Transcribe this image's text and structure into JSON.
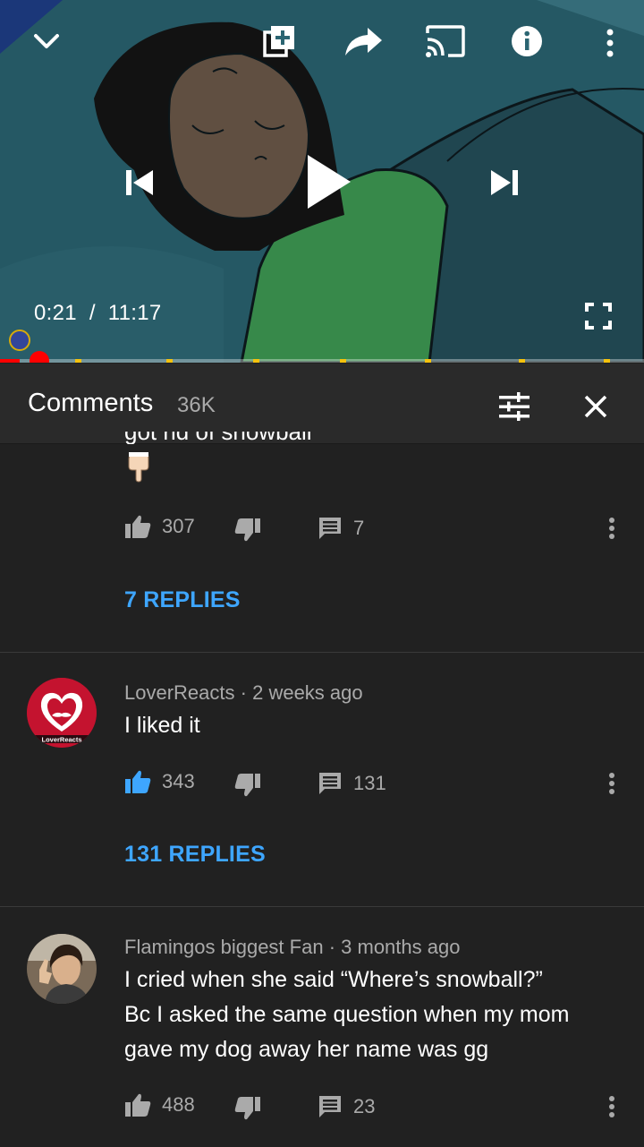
{
  "player": {
    "current_time": "0:21",
    "duration": "11:17",
    "progress_fraction": 0.031,
    "icons": [
      "chevron-down-icon",
      "add-to-playlist-icon",
      "share-icon",
      "cast-icon",
      "info-icon",
      "more-vert-icon",
      "previous-icon",
      "play-icon",
      "next-icon",
      "fullscreen-icon"
    ]
  },
  "comments_panel": {
    "title": "Comments",
    "count": "36K",
    "icons": [
      "sort-icon",
      "close-icon"
    ]
  },
  "comments": [
    {
      "author": "",
      "age": "",
      "text": "got rid of snowball",
      "likes": "307",
      "reply_count": "7",
      "replies_label": "7 REPLIES",
      "liked": false
    },
    {
      "author": "LoverReacts",
      "age": "2 weeks ago",
      "text": "I liked it",
      "likes": "343",
      "reply_count": "131",
      "replies_label": "131 REPLIES",
      "liked": true,
      "avatar_text": "LoverReacts"
    },
    {
      "author": "Flamingos biggest Fan",
      "age": "3 months ago",
      "text": "I cried when she said “Where’s snowball?”\nBc I asked the same question when my mom\ngave my dog away her name was gg",
      "likes": "488",
      "reply_count": "23",
      "liked": false
    }
  ],
  "colors": {
    "background": "#212121",
    "header": "#2a2a2a",
    "accent_blue": "#3ea6ff",
    "progress_red": "#ff0000",
    "muted_text": "#aaaaaa"
  }
}
